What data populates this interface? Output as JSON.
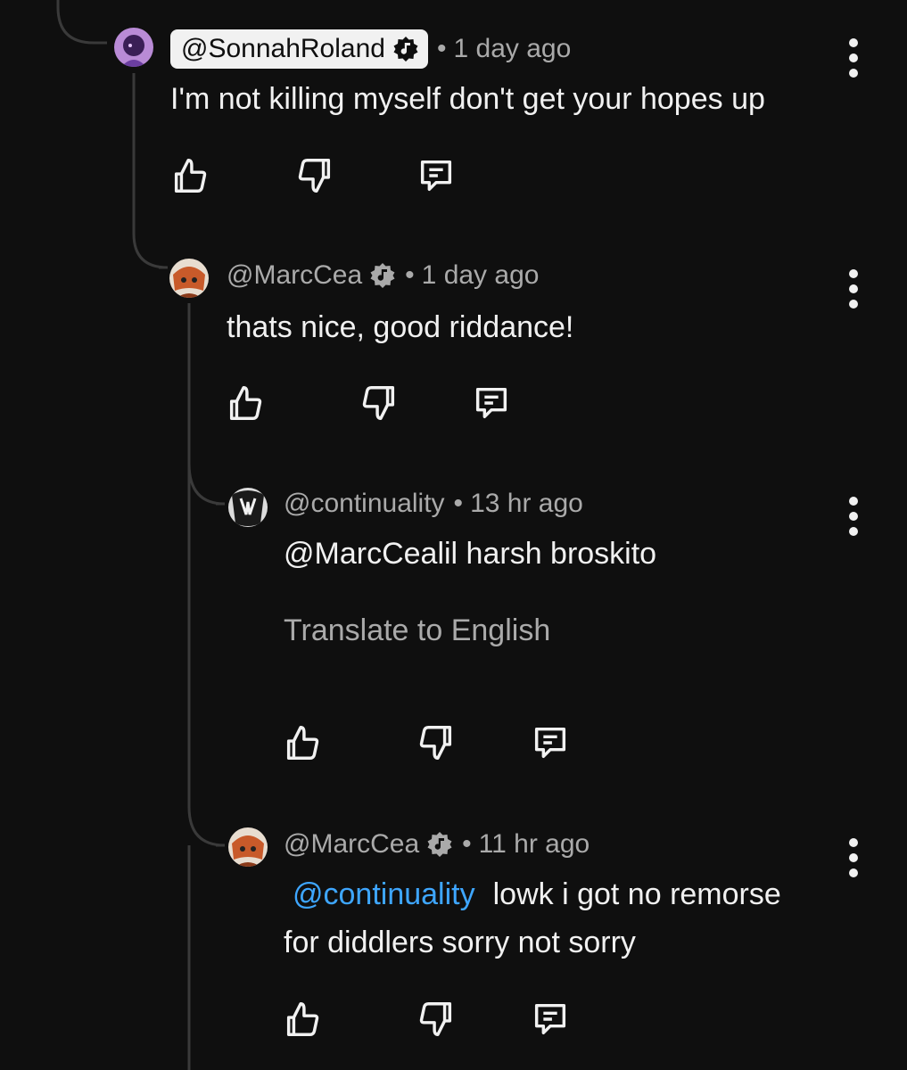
{
  "comments": [
    {
      "handle": "@SonnahRoland",
      "verified_icon": "music-note-badge-icon",
      "time": "1 day ago",
      "text": "I'm not killing myself don't get your hopes up",
      "highlighted": true,
      "avatar_color": "#7a4aa8"
    },
    {
      "handle": "@MarcCea",
      "verified_icon": "music-note-badge-icon",
      "time": "1 day ago",
      "text": "thats nice, good riddance!",
      "avatar_color": "#c85a2a"
    },
    {
      "handle": "@continuality",
      "time": "13 hr ago",
      "text": "@MarcCealil harsh broskito",
      "translate": "Translate to English",
      "avatar_color": "#222222"
    },
    {
      "handle": "@MarcCea",
      "verified_icon": "music-note-badge-icon",
      "time": "11 hr ago",
      "mention": "@continuality",
      "text_line1": "lowk i got no remorse",
      "text_line2": "for diddlers sorry not sorry",
      "avatar_color": "#c85a2a"
    }
  ],
  "separator": "•",
  "icons": [
    "thumbs-up-icon",
    "thumbs-down-icon",
    "reply-icon",
    "more-vert-icon"
  ],
  "colors": {
    "background": "#0f0f0f",
    "text": "#f1f1f1",
    "secondary_text": "#aaaaaa",
    "mention": "#3ea6ff",
    "thread_line": "#3a3a3a"
  }
}
